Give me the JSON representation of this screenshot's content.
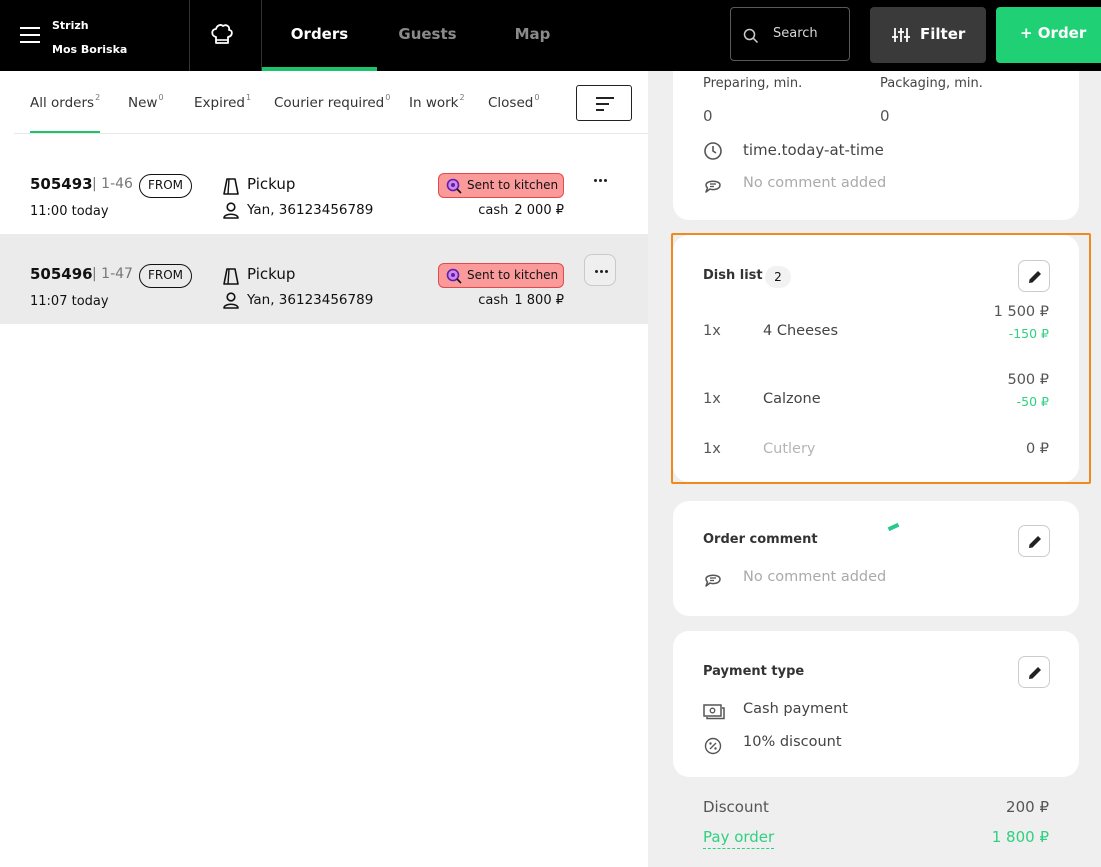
{
  "topbar": {
    "company": "Strizh",
    "location": "Mos Boriska",
    "tabs": [
      "Orders",
      "Guests",
      "Map"
    ],
    "search_placeholder": "Search",
    "filter_label": "Filter",
    "order_label": "+ Order",
    "accent": "#1bc46a"
  },
  "filter_tabs": [
    {
      "label": "All orders",
      "count": "2"
    },
    {
      "label": "New",
      "count": "0"
    },
    {
      "label": "Expired",
      "count": "1"
    },
    {
      "label": "Courier required",
      "count": "0"
    },
    {
      "label": "In work",
      "count": "2"
    },
    {
      "label": "Closed",
      "count": "0"
    }
  ],
  "orders": [
    {
      "number": "505493",
      "slot": "| 1-46",
      "source": "FROM",
      "time": "11:00 today",
      "type": "Pickup",
      "guest": "Yan, 36123456789",
      "status": "Sent to kitchen",
      "payment": "cash",
      "amount": "2 000 ₽"
    },
    {
      "number": "505496",
      "slot": "| 1-47",
      "source": "FROM",
      "time": "11:07 today",
      "type": "Pickup",
      "guest": "Yan, 36123456789",
      "status": "Sent to kitchen",
      "payment": "cash",
      "amount": "1 800 ₽"
    }
  ],
  "details": {
    "preparing_label": "Preparing, min.",
    "preparing_value": "0",
    "packaging_label": "Packaging, min.",
    "packaging_value": "0",
    "time_text": "time.today-at-time",
    "no_comment": "No comment added",
    "dish_list_title": "Dish list",
    "dish_count": "2",
    "dishes": [
      {
        "qty": "1x",
        "name": "4 Cheeses",
        "price": "1 500 ₽",
        "discount": "-150 ₽"
      },
      {
        "qty": "1x",
        "name": "Calzone",
        "price": "500 ₽",
        "discount": "-50 ₽"
      },
      {
        "qty": "1x",
        "name": "Cutlery",
        "price": "0 ₽",
        "discount": ""
      }
    ],
    "order_comment_title": "Order comment",
    "order_comment_text": "No comment added",
    "payment_type_title": "Payment type",
    "payment_method": "Cash payment",
    "payment_discount": "10% discount",
    "discount_label": "Discount",
    "discount_value": "200 ₽",
    "pay_label": "Pay order",
    "pay_value": "1 800 ₽"
  }
}
